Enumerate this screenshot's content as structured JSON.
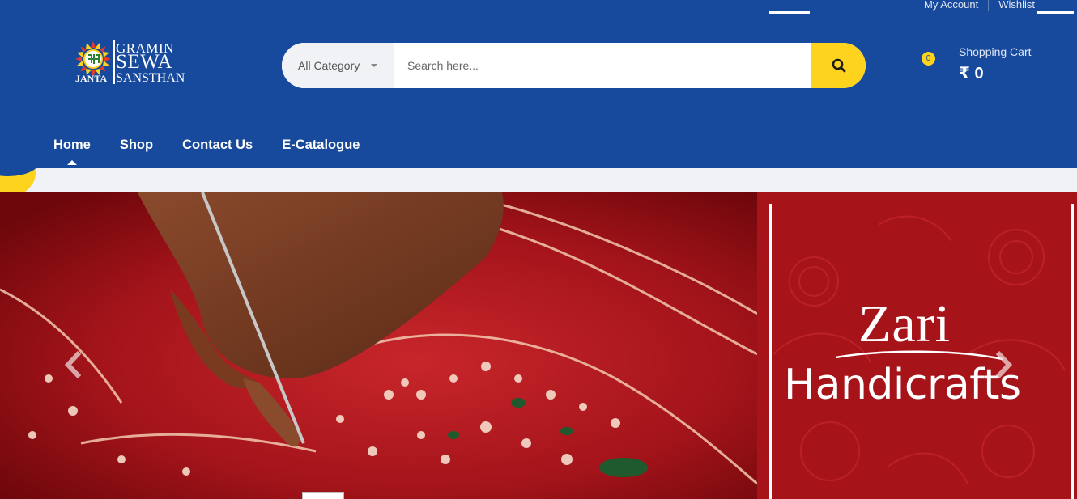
{
  "top_links": [
    "My Account",
    "Wishlist"
  ],
  "logo": {
    "line1": "GRAMIN",
    "line2": "SEWA",
    "line3_left": "JANTA",
    "line3_right": "SANSTHAN"
  },
  "search": {
    "category_label": "All Category",
    "placeholder": "Search here..."
  },
  "cart": {
    "count": "0",
    "label": "Shopping Cart",
    "amount": "₹ 0"
  },
  "nav": {
    "items": [
      "Home",
      "Shop",
      "Contact Us",
      "E-Catalogue"
    ],
    "active": "Home"
  },
  "hero": {
    "title_line1": "Zari",
    "title_line2": "Handicrafts"
  },
  "colors": {
    "brand_blue": "#174a9c",
    "accent_yellow": "#fdd31d",
    "hero_red": "#a6141a"
  },
  "icons": {
    "search": "search-icon",
    "prev": "chevron-left-icon",
    "next": "chevron-right-icon",
    "caret": "caret-down-icon"
  }
}
